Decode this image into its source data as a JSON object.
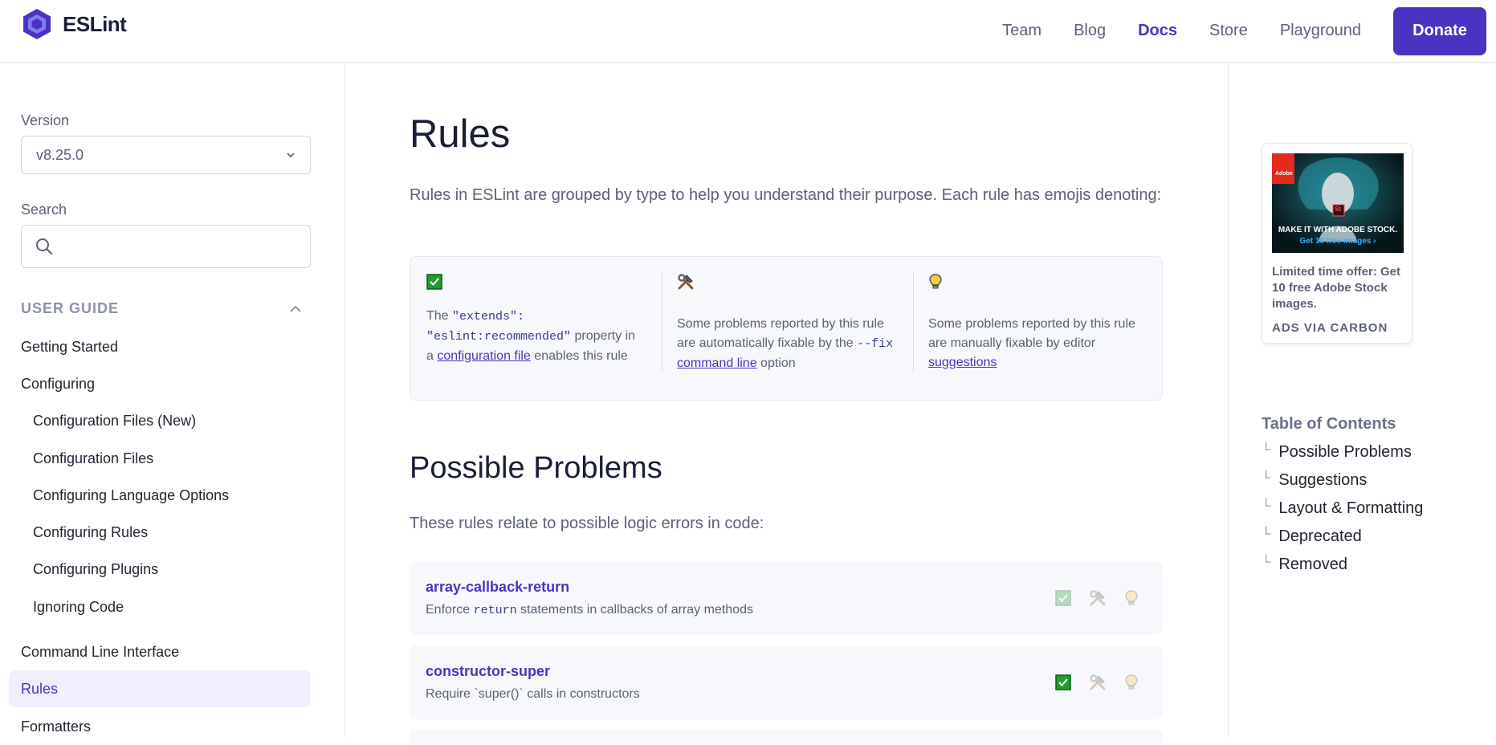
{
  "header": {
    "brand": "ESLint",
    "nav": [
      "Team",
      "Blog",
      "Docs",
      "Store",
      "Playground"
    ],
    "active_nav": "Docs",
    "donate_label": "Donate",
    "accent": "#4b32c3"
  },
  "sidebar": {
    "version_label": "Version",
    "version_value": "v8.25.0",
    "search_label": "Search",
    "search_placeholder": "",
    "section_title": "USER GUIDE",
    "items": [
      {
        "label": "Getting Started"
      },
      {
        "label": "Configuring"
      },
      {
        "label": "Configuration Files (New)"
      },
      {
        "label": "Configuration Files"
      },
      {
        "label": "Configuring Language Options"
      },
      {
        "label": "Configuring Rules"
      },
      {
        "label": "Configuring Plugins"
      },
      {
        "label": "Ignoring Code"
      },
      {
        "label": "Command Line Interface"
      },
      {
        "label": "Rules"
      },
      {
        "label": "Formatters"
      }
    ],
    "current": "Rules"
  },
  "main": {
    "title": "Rules",
    "intro": "Rules in ESLint are grouped by type to help you understand their purpose. Each rule has emojis denoting:",
    "legend": {
      "recommended": {
        "pre": "The ",
        "code1": "\"extends\": \"eslint:recommended\"",
        "mid": " property in a ",
        "link": "configuration file",
        "post": " enables this rule"
      },
      "fixable": {
        "pre": "Some problems reported by this rule are automatically fixable by the ",
        "code": "--fix",
        "link": "command line",
        "post": " option"
      },
      "suggestions": {
        "pre": "Some problems reported by this rule are manually fixable by editor ",
        "link": "suggestions"
      }
    },
    "section_title": "Possible Problems",
    "section_desc": "These rules relate to possible logic errors in code:",
    "rules": [
      {
        "name": "array-callback-return",
        "desc_pre": "Enforce ",
        "desc_code": "return",
        "desc_post": " statements in callbacks of array methods",
        "recommended": false
      },
      {
        "name": "constructor-super",
        "desc_pre": "Require `super()` calls in constructors",
        "desc_code": "",
        "desc_post": "",
        "recommended": true
      }
    ]
  },
  "ad": {
    "image_headline": "MAKE IT WITH ADOBE STOCK.",
    "image_sub": "Get 10 free images ›",
    "brand_mark": "Adobe",
    "product_mark": "St",
    "text": "Limited time offer: Get 10 free Adobe Stock images.",
    "via": "ADS VIA CARBON"
  },
  "toc": {
    "title": "Table of Contents",
    "items": [
      "Possible Problems",
      "Suggestions",
      "Layout & Formatting",
      "Deprecated",
      "Removed"
    ]
  }
}
